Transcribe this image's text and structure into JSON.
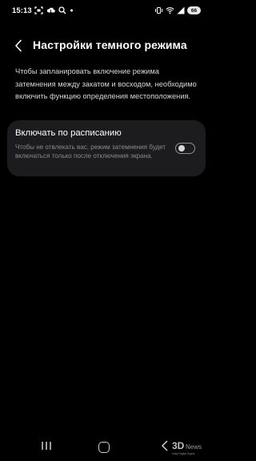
{
  "status_bar": {
    "time": "15:13",
    "battery_level": "66",
    "left_icons": [
      "screenshot-icon",
      "cloud-icon",
      "search-icon",
      "dot-icon"
    ],
    "right_icons": [
      "vibrate-icon",
      "wifi-icon",
      "signal-icon",
      "battery-icon"
    ]
  },
  "header": {
    "title": "Настройки темного режима",
    "back_icon": "chevron-left-icon"
  },
  "description": "Чтобы запланировать включение режима затемнения между закатом и восходом, необходимо включить функцию определения местоположения.",
  "schedule_setting": {
    "title": "Включать по расписанию",
    "subtitle": "Чтобы не отвлекать вас, режим затемнения будет включаться только после отключения экрана.",
    "enabled": false
  },
  "nav_bar": {
    "icons": [
      "recents-icon",
      "home-icon",
      "back-icon"
    ]
  },
  "watermark": {
    "brand": "3D",
    "tagline": "Daily Digital Digest"
  },
  "colors": {
    "background": "#000000",
    "card": "#1c1c1e",
    "text_primary": "#ffffff",
    "text_secondary": "#8a8a8e",
    "toggle_off": "#8e8e93"
  }
}
